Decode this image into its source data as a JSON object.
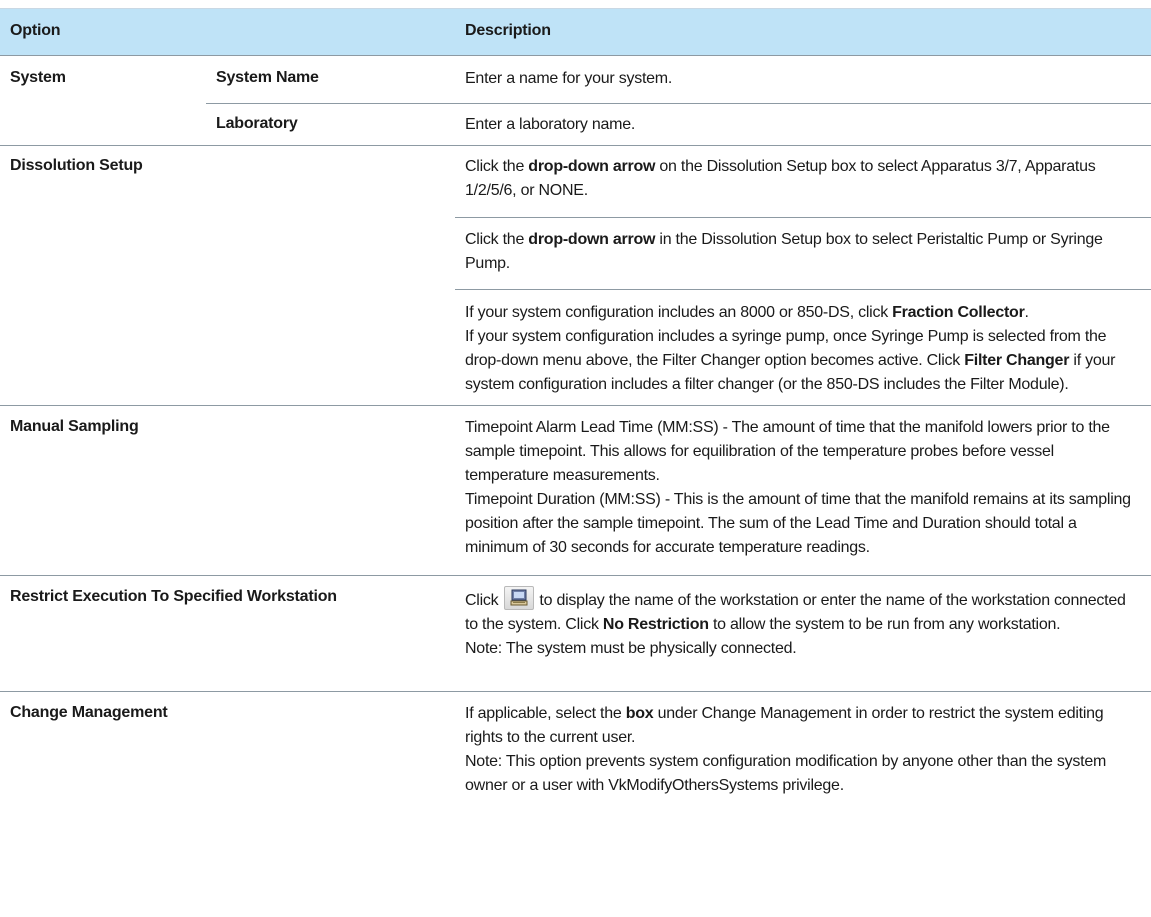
{
  "table": {
    "header": {
      "option": "Option",
      "description": "Description"
    },
    "rows": {
      "system": {
        "option": "System"
      },
      "system_name": {
        "sub": "System Name",
        "desc": "Enter a name for your system."
      },
      "laboratory": {
        "sub": "Laboratory",
        "desc": "Enter a laboratory name."
      },
      "dissolution": {
        "option": "Dissolution Setup",
        "d1_a": "Click the ",
        "d1_b": "drop-down arrow",
        "d1_c": " on the Dissolution Setup box to select Apparatus 3/7, Apparatus 1/2/5/6, or NONE.",
        "d2_a": "Click the ",
        "d2_b": "drop-down arrow",
        "d2_c": " in the Dissolution Setup box to select Peristaltic Pump or Syringe Pump.",
        "d3_a": "If your system configuration includes an 8000 or 850-DS, click ",
        "d3_b": "Fraction Collector",
        "d3_c": ".",
        "d3_d": "If your system configuration includes a syringe pump, once Syringe Pump is selected from the drop-down menu above, the Filter Changer option becomes active. Click ",
        "d3_e": "Filter Changer",
        "d3_f": " if your system configuration includes a filter changer (or the 850-DS includes the Filter Module)."
      },
      "manual": {
        "option": "Manual Sampling",
        "p1": "Timepoint Alarm Lead Time (MM:SS) - The amount of time that the manifold lowers prior to the sample timepoint. This allows for equilibration of the temperature probes before vessel temperature measurements.",
        "p2": "Timepoint Duration (MM:SS) - This is the amount of time that the manifold remains at its sampling position after the sample timepoint. The sum of the Lead Time and Duration should total a minimum of 30 seconds for accurate temperature readings."
      },
      "restrict": {
        "option": "Restrict Execution To Specified Workstation",
        "a": "Click",
        "b": "to display the name of the workstation or enter the name of the workstation connected to the system. Click ",
        "c": "No Restriction",
        "d": " to allow the system to be run from any workstation.",
        "note": "Note: The system must be physically connected."
      },
      "change": {
        "option": "Change Management",
        "a": "If applicable, select the ",
        "b": "box",
        "c": " under Change Management in order to restrict the system editing rights to the current user.",
        "note": "Note: This option prevents system configuration modification by anyone other than the system owner or a user with VkModifyOthersSystems privilege."
      }
    }
  },
  "icons": {
    "workstation": "workstation-computer-icon"
  }
}
